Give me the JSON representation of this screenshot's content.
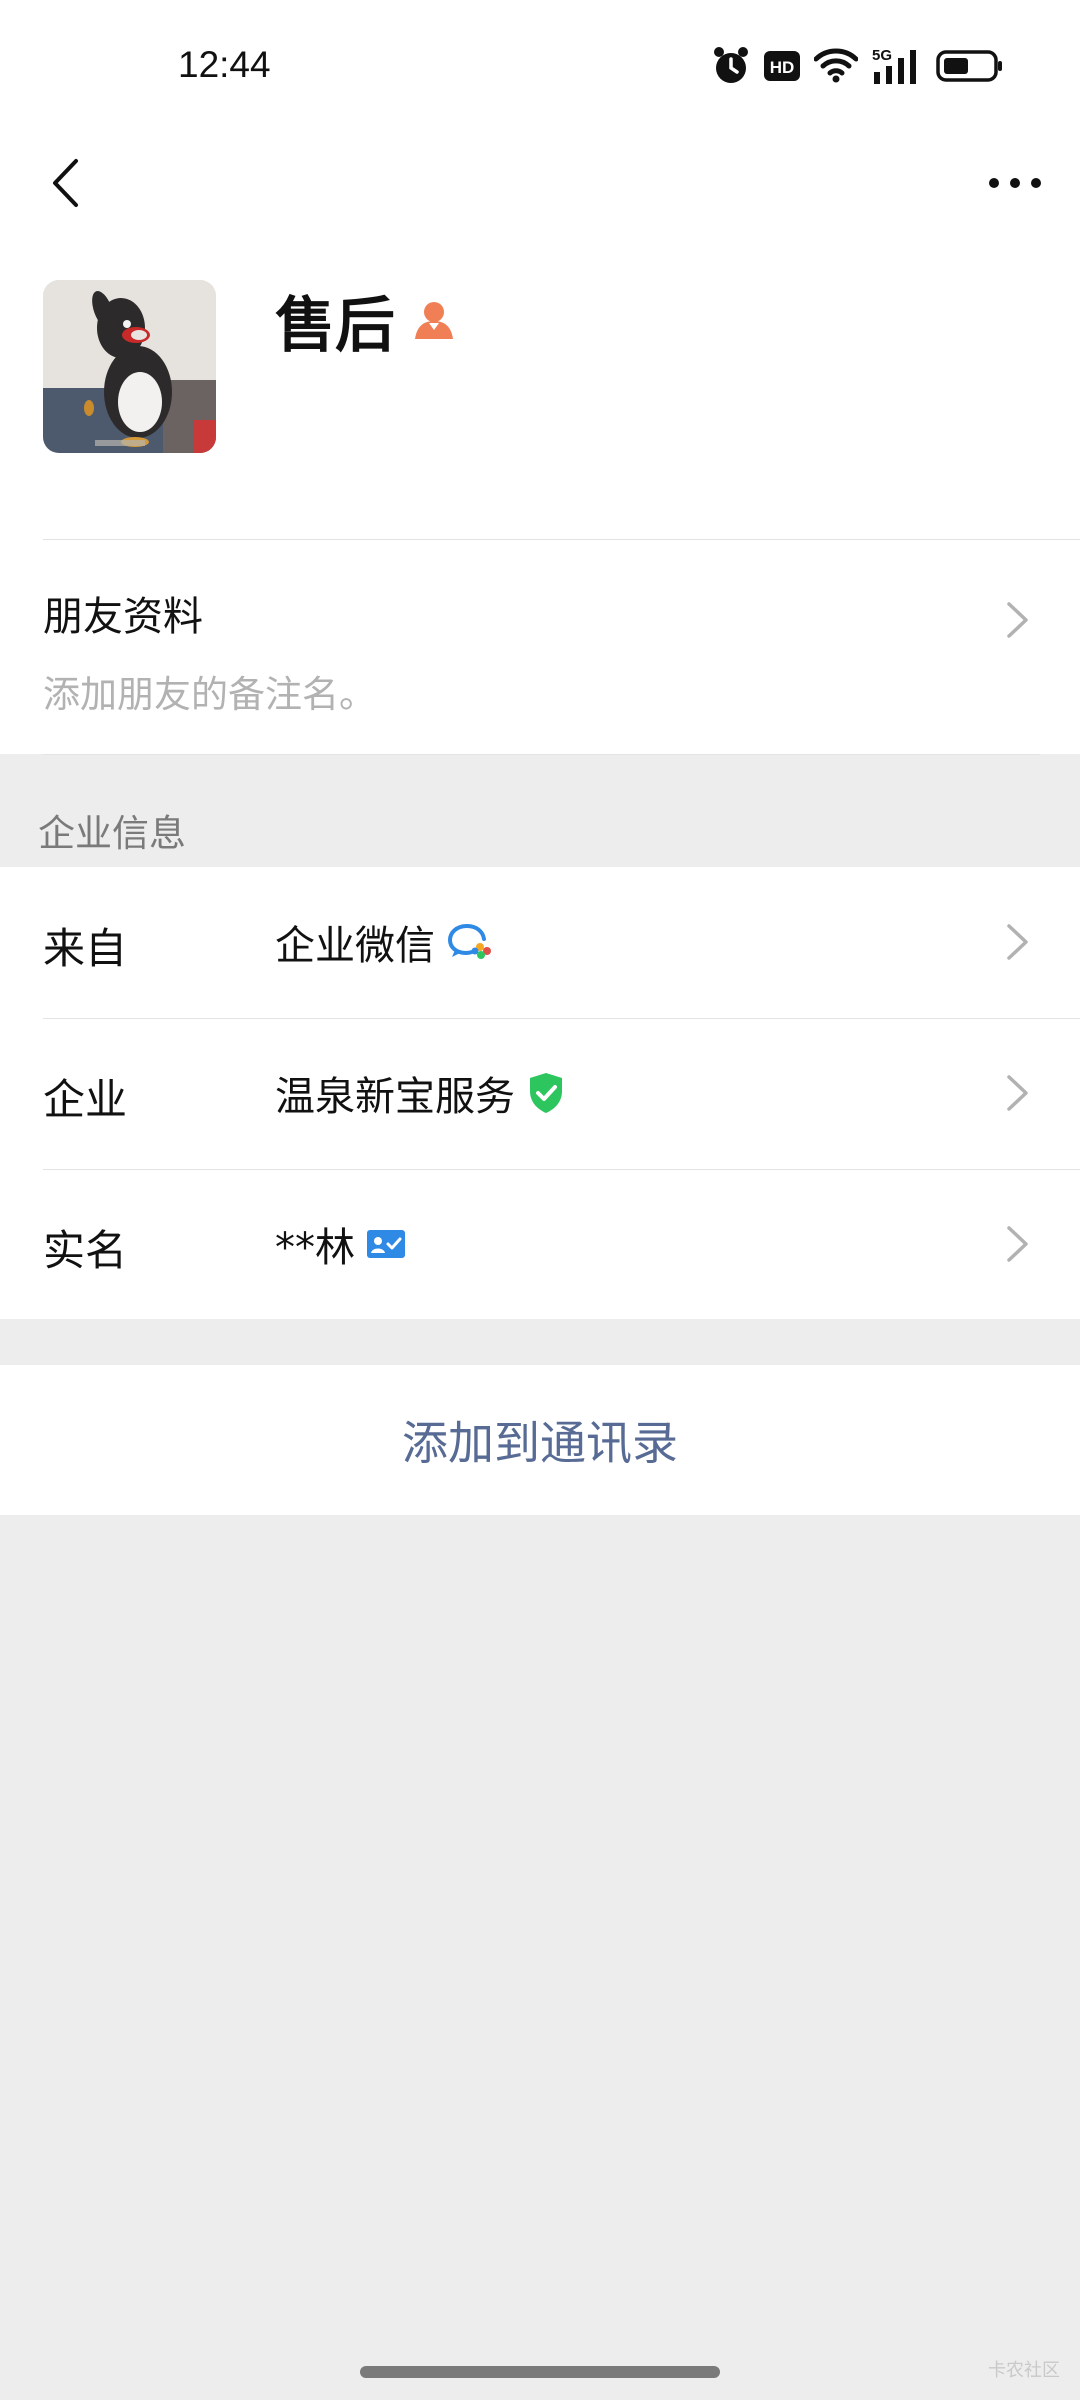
{
  "status_bar": {
    "time": "12:44",
    "network_label": "5G",
    "hd_label": "HD",
    "icons": [
      "alarm-icon",
      "hd-icon",
      "wifi-icon",
      "5g-signal-icon",
      "battery-icon"
    ]
  },
  "nav": {
    "back_icon": "chevron-left-icon",
    "more_icon": "more-dots-icon"
  },
  "profile": {
    "name": "售后",
    "badge_icon": "person-icon",
    "badge_color": "#f07f55"
  },
  "friend_info": {
    "title": "朋友资料",
    "hint": "添加朋友的备注名。"
  },
  "enterprise_section": {
    "header": "企业信息",
    "rows": [
      {
        "label": "来自",
        "value": "企业微信",
        "icon": "wecom-icon"
      },
      {
        "label": "企业",
        "value": "温泉新宝服务",
        "icon": "verified-shield-icon",
        "icon_color": "#2dc55e"
      },
      {
        "label": "实名",
        "value": "**林",
        "icon": "id-card-icon",
        "icon_color": "#2f8ae5"
      }
    ]
  },
  "actions": {
    "add_to_contacts": "添加到通讯录",
    "link_color": "#576b95"
  },
  "watermark": "卡农社区"
}
